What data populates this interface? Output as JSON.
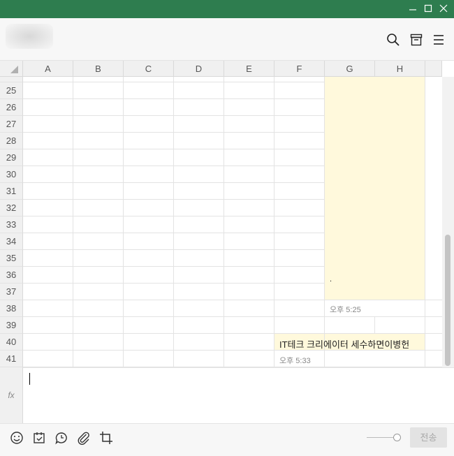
{
  "window": {
    "buttons": [
      {
        "name": "minimize-icon"
      },
      {
        "name": "maximize-icon"
      },
      {
        "name": "close-icon"
      }
    ],
    "colors": {
      "titlebar": "#2e7d4f",
      "bubble": "#fff9dc"
    }
  },
  "header": {
    "icons": [
      "search-icon",
      "archive-icon",
      "menu-icon"
    ]
  },
  "sheet": {
    "columns": [
      "A",
      "B",
      "C",
      "D",
      "E",
      "F",
      "G",
      "H"
    ],
    "rows": [
      "25",
      "26",
      "27",
      "28",
      "29",
      "30",
      "31",
      "32",
      "33",
      "34",
      "35",
      "36",
      "37",
      "38",
      "39",
      "40",
      "41"
    ]
  },
  "messages": [
    {
      "text": "",
      "dot": ".",
      "time": "오후 5:25"
    },
    {
      "text": "IT테크 크리에이터 세수하면이병헌",
      "time": "오후 5:33"
    }
  ],
  "input": {
    "fx_label": "fx",
    "value": ""
  },
  "toolbar": {
    "icons": [
      "emoji-icon",
      "calendar-icon",
      "speech-bubble-icon",
      "paperclip-icon",
      "crop-icon"
    ],
    "send_label": "전송"
  }
}
